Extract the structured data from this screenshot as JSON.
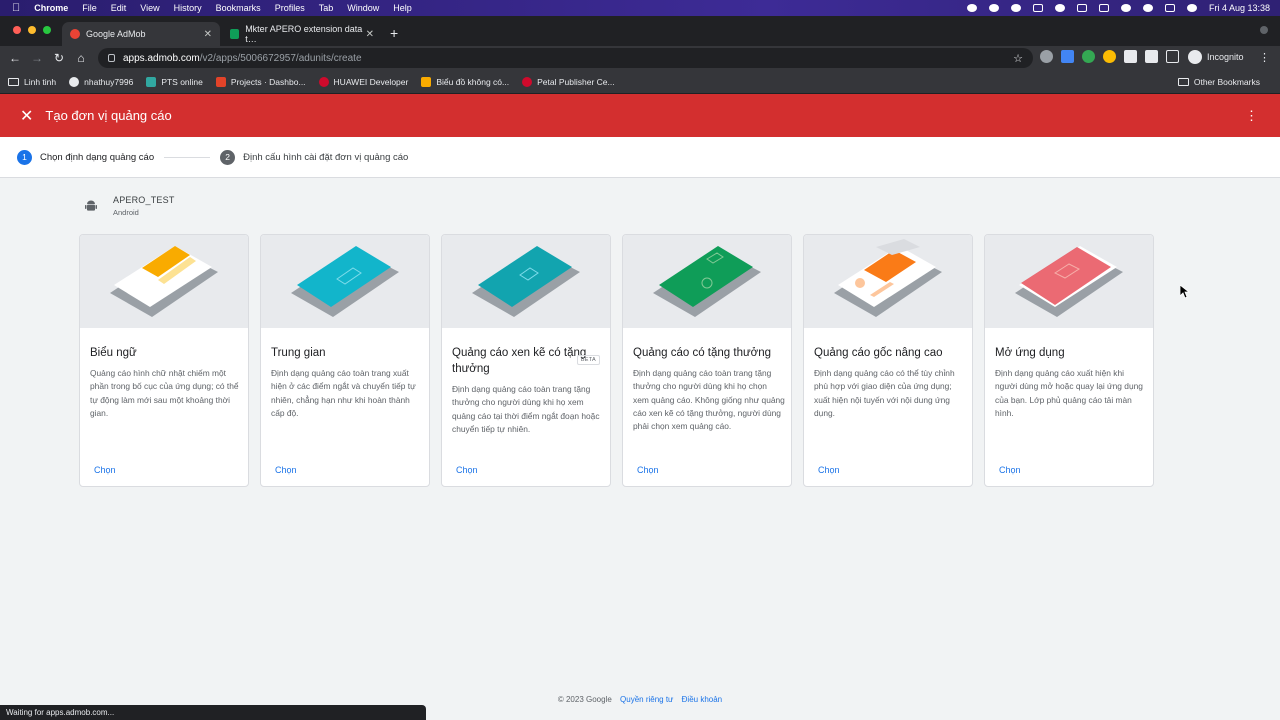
{
  "macos": {
    "apple_icon": "apple-icon",
    "app_name": "Chrome",
    "menus": [
      "File",
      "Edit",
      "View",
      "History",
      "Bookmarks",
      "Profiles",
      "Tab",
      "Window",
      "Help"
    ],
    "clock": "Fri 4 Aug  13:38"
  },
  "browser": {
    "tabs": [
      {
        "title": "Google AdMob",
        "active": true,
        "favicon_color": "#ea4335"
      },
      {
        "title": "Mkter APERO extension data t…",
        "active": false,
        "favicon_color": "#0f9d58"
      }
    ],
    "url_host": "apps.admob.com",
    "url_path": "/v2/apps/5006672957/adunits/create",
    "profile_label": "Incognito",
    "bookmarks": [
      {
        "label": "Linh tinh",
        "icon": "folder-icon",
        "color": "#e8eaed"
      },
      {
        "label": "nhathuy7996",
        "icon": "github-icon",
        "color": "#e8eaed"
      },
      {
        "label": "PTS online",
        "icon": "pts-icon",
        "color": "#31a8a1"
      },
      {
        "label": "Projects · Dashbo...",
        "icon": "gitlab-icon",
        "color": "#e24329"
      },
      {
        "label": "HUAWEI Developer",
        "icon": "huawei-icon",
        "color": "#cf0a2c"
      },
      {
        "label": "Biểu đồ không có...",
        "icon": "chart-icon",
        "color": "#f9ab00"
      },
      {
        "label": "Petal Publisher Ce...",
        "icon": "petal-icon",
        "color": "#cf0a2c"
      }
    ],
    "other_bookmarks": "Other Bookmarks",
    "status_text": "Waiting for apps.admob.com..."
  },
  "header": {
    "title": "Tạo đơn vị quảng cáo",
    "color": "#d32f2f"
  },
  "stepper": [
    {
      "num": "1",
      "label": "Chọn định dạng quảng cáo"
    },
    {
      "num": "2",
      "label": "Định cấu hình cài đặt đơn vị quảng cáo"
    }
  ],
  "app": {
    "name": "APERO_TEST",
    "platform": "Android"
  },
  "formats": [
    {
      "title": "Biểu ngữ",
      "desc": "Quảng cáo hình chữ nhật chiếm một phần trong bố cục của ứng dụng; có thể tự động làm mới sau một khoảng thời gian.",
      "cta": "Chọn",
      "accent": "#f9ab00"
    },
    {
      "title": "Trung gian",
      "desc": "Định dạng quảng cáo toàn trang xuất hiện ở các điểm ngắt và chuyển tiếp tự nhiên, chẳng hạn như khi hoàn thành cấp độ.",
      "cta": "Chọn",
      "accent": "#12b5cb"
    },
    {
      "title": "Quảng cáo xen kẽ có tặng thưởng",
      "badge": "BETA",
      "desc": "Định dạng quảng cáo toàn trang tặng thưởng cho người dùng khi họ xem quảng cáo tại thời điểm ngắt đoạn hoặc chuyển tiếp tự nhiên.",
      "cta": "Chọn",
      "accent": "#12a4af"
    },
    {
      "title": "Quảng cáo có tặng thưởng",
      "desc": "Định dạng quảng cáo toàn trang tặng thưởng cho người dùng khi họ chọn xem quảng cáo. Không giống như quảng cáo xen kẽ có tặng thưởng, người dùng phải chọn xem quảng cáo.",
      "cta": "Chọn",
      "accent": "#0f9d58"
    },
    {
      "title": "Quảng cáo gốc nâng cao",
      "desc": "Định dạng quảng cáo có thể tùy chỉnh phù hợp với giao diện của ứng dụng; xuất hiện nội tuyến với nội dung ứng dụng.",
      "cta": "Chọn",
      "accent": "#fa7b17"
    },
    {
      "title": "Mở ứng dụng",
      "desc": "Định dạng quảng cáo xuất hiện khi người dùng mở hoặc quay lại ứng dụng của bạn. Lớp phủ quảng cáo tải màn hình.",
      "cta": "Chọn",
      "accent": "#e8505b"
    }
  ],
  "footer": {
    "copyright": "© 2023 Google",
    "privacy": "Quyền riêng tư",
    "terms": "Điều khoản"
  }
}
